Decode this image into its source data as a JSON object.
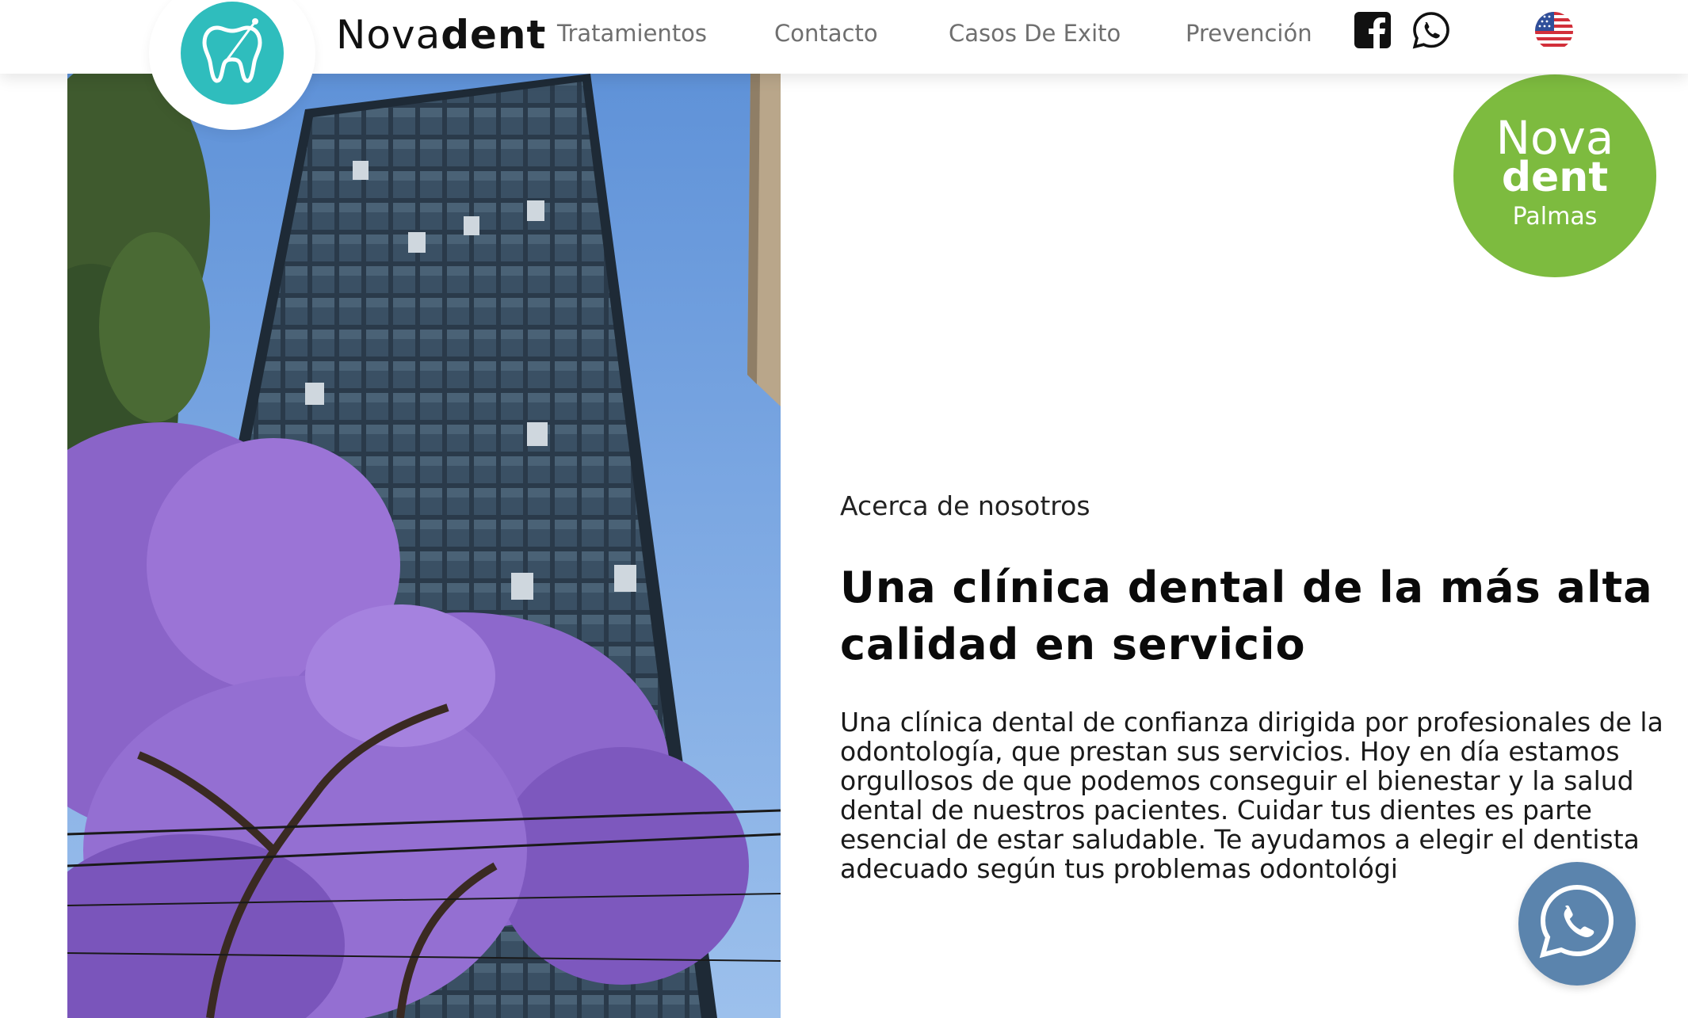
{
  "header": {
    "brand_light": "Nova",
    "brand_bold": "dent",
    "nav": [
      {
        "label": "Tratamientos"
      },
      {
        "label": "Contacto"
      },
      {
        "label": "Casos De Exito"
      },
      {
        "label": "Prevención"
      }
    ],
    "icons": {
      "logo": "tooth-icon",
      "facebook": "facebook-icon",
      "whatsapp": "whatsapp-icon",
      "language": "us-flag-icon"
    }
  },
  "badge": {
    "line1": "Nova",
    "line2": "dent",
    "line3": "Palmas"
  },
  "about": {
    "eyebrow": "Acerca de nosotros",
    "headline": "Una clínica dental de la más alta calidad en servicio",
    "body": "Una clínica dental de confianza dirigida por profesionales de la odontología, que prestan sus servicios. Hoy en día estamos orgullosos de que podemos conseguir el bienestar y la salud dental de nuestros pacientes. Cuidar tus dientes es parte esencial de estar saludable. Te ayudamos a elegir el dentista adecuado según tus problemas odontológi"
  },
  "colors": {
    "teal": "#2fbdbd",
    "green": "#7dbb3f",
    "whatsapp_fab": "#5b84ad",
    "nav_text": "#6f6f6f"
  }
}
